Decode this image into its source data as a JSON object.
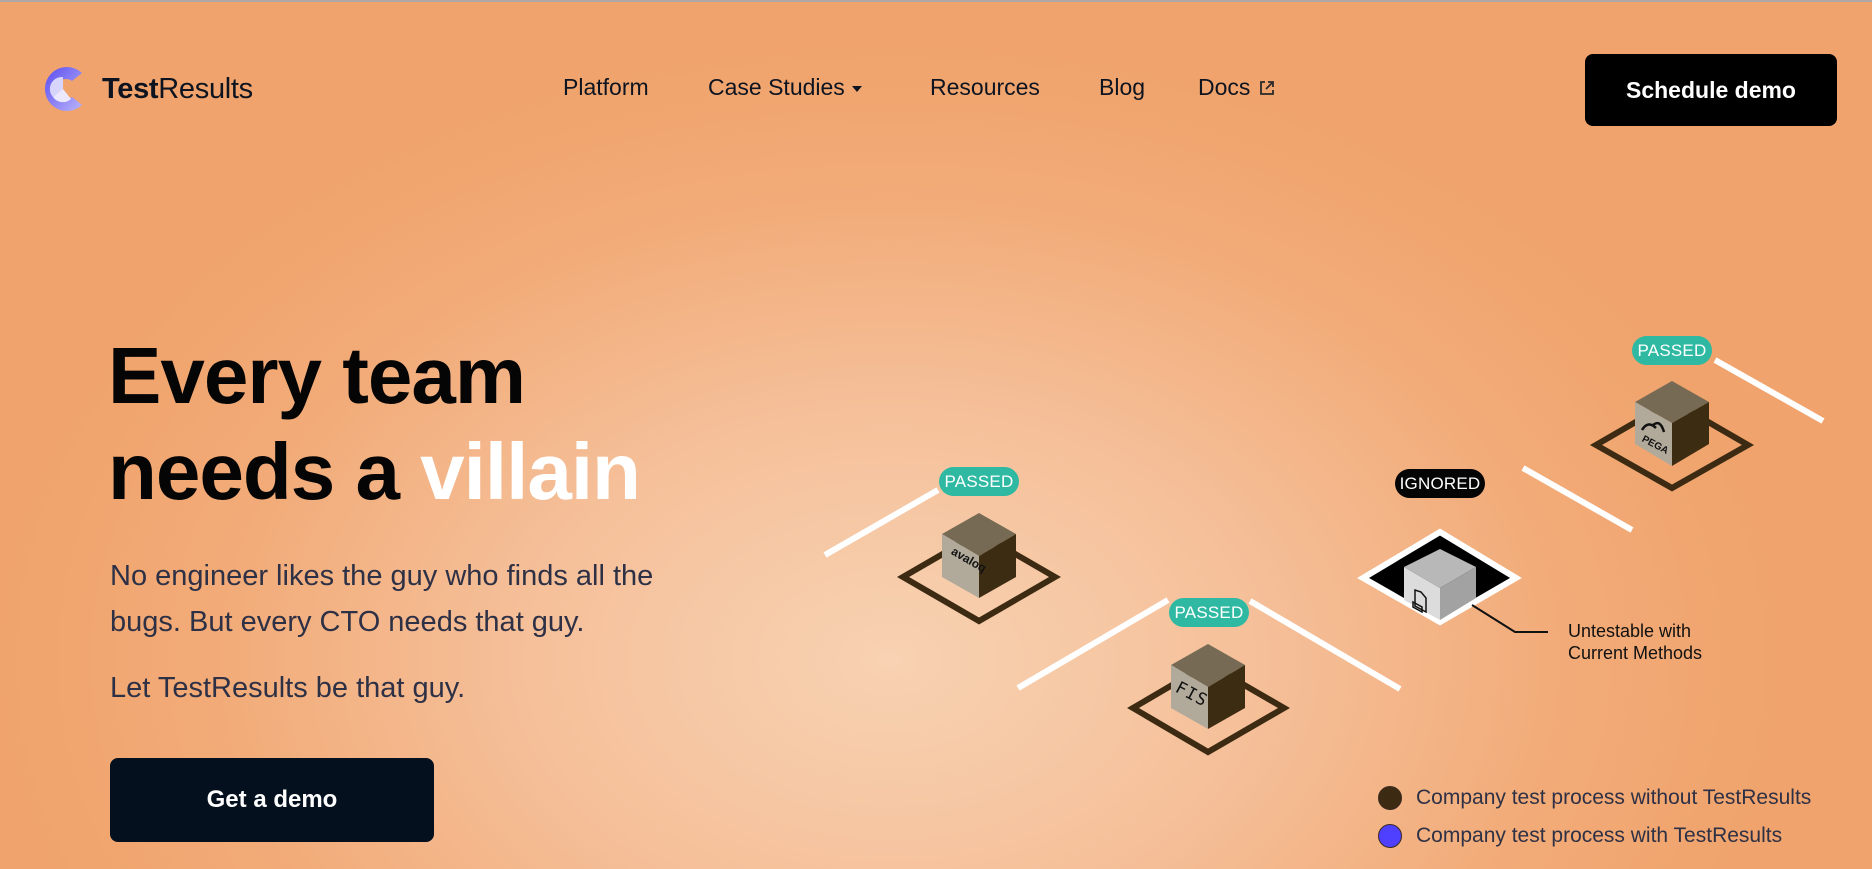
{
  "brand": {
    "name_bold": "Test",
    "name_regular": "Results",
    "logo_icon": "c-ring-logo-icon"
  },
  "nav": {
    "items": [
      {
        "label": "Platform"
      },
      {
        "label": "Case Studies",
        "icon": "caret-down-icon"
      },
      {
        "label": "Resources"
      },
      {
        "label": "Blog"
      },
      {
        "label": "Docs",
        "icon": "external-link-icon"
      }
    ],
    "cta": "Schedule demo"
  },
  "hero": {
    "title_line1": "Every team",
    "title_line2_prefix": "needs a ",
    "title_line2_accent": "villain",
    "subtitle": "No engineer likes the guy who finds all the bugs. But every CTO needs that guy.",
    "subtitle2": "Let TestResults be that guy.",
    "cta": "Get a demo"
  },
  "diagram": {
    "nodes": [
      {
        "status": "PASSED",
        "logo": "avaloq"
      },
      {
        "status": "PASSED",
        "logo": "FIS"
      },
      {
        "status": "IGNORED",
        "logo": "document"
      },
      {
        "status": "PASSED",
        "logo": "PEGA"
      }
    ],
    "annotation_line1": "Untestable with",
    "annotation_line2": "Current Methods"
  },
  "legend": [
    {
      "label": "Company test process without TestResults",
      "color": "#3c2a12"
    },
    {
      "label": "Company test process with TestResults",
      "color": "#4f40ff"
    }
  ],
  "colors": {
    "passed": "#2fb9a2",
    "ignored": "#050505",
    "accent_text": "#ffffff",
    "button_dark": "#05101e"
  }
}
